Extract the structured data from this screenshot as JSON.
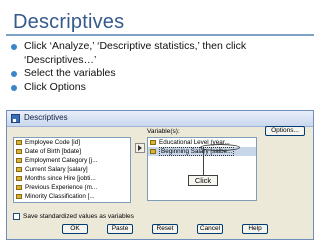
{
  "slide": {
    "title": "Descriptives",
    "bullets": [
      "Click ‘Analyze,’ ‘Descriptive statistics,’ then click ‘Descriptives…’",
      "Select the variables",
      "Click Options"
    ]
  },
  "dialog": {
    "title": "Descriptives",
    "variables_label": "Variable(s):",
    "source_items": [
      "Employee Code [id]",
      "Date of Birth [bdate]",
      "Employment Category [j...",
      "Current Salary [salary]",
      "Months since Hire [jobti...",
      "Previous Experience (m...",
      "Minority Classification [..."
    ],
    "target_items": [
      "Educational Level (year...",
      "Beginning Salary [salbe..."
    ],
    "options_button": "Options...",
    "save_checkbox_label": "Save standardized values as variables",
    "save_checked": false,
    "buttons": {
      "ok": "OK",
      "paste": "Paste",
      "reset": "Reset",
      "cancel": "Cancel",
      "help": "Help"
    }
  },
  "annotation": {
    "callout": "Click"
  },
  "colors": {
    "title": "#355a8c",
    "bullet": "#3b86c7",
    "dialog_bg": "#ece9d8"
  },
  "icons": [
    "variable-icon",
    "move-arrow-icon",
    "dialog-icon"
  ]
}
